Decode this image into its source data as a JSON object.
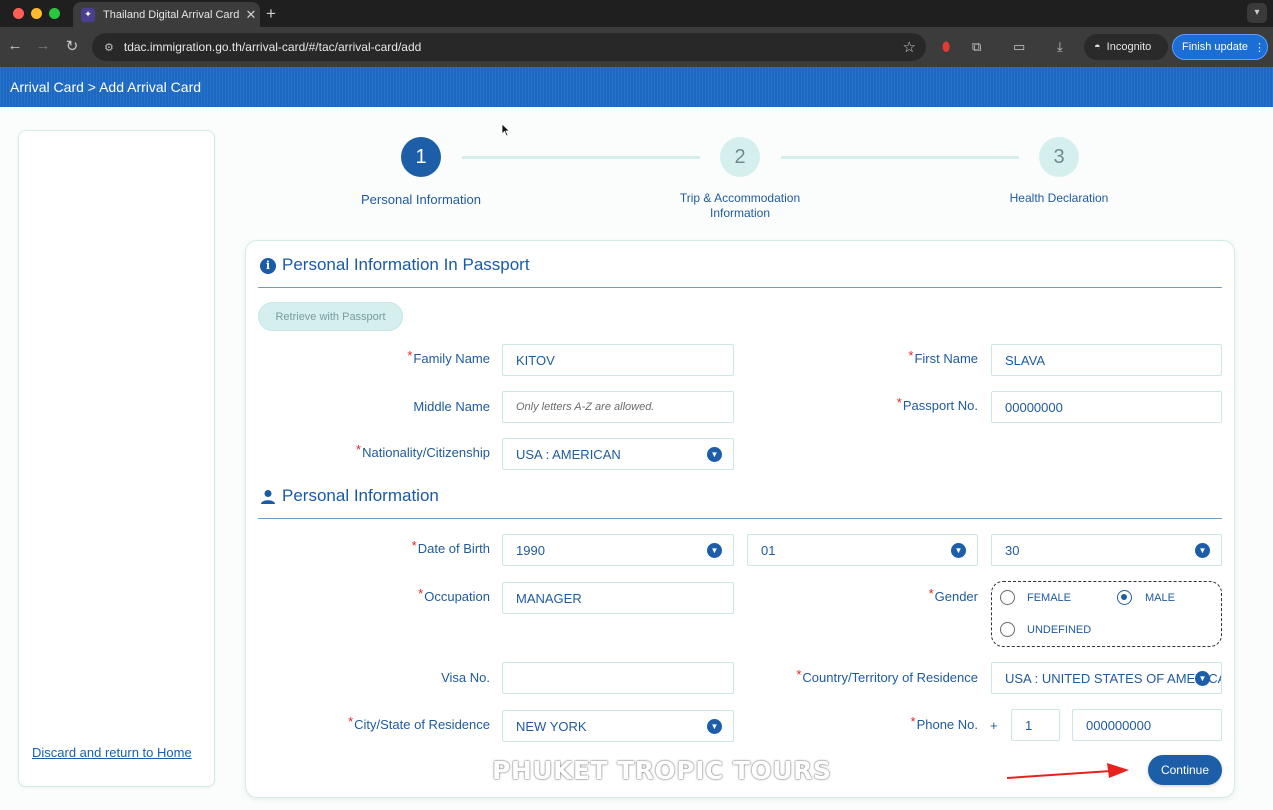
{
  "browser": {
    "tab_title": "Thailand Digital Arrival Card",
    "url": "tdac.immigration.go.th/arrival-card/#/tac/arrival-card/add",
    "incognito_label": "Incognito",
    "update_label": "Finish update"
  },
  "header": {
    "breadcrumb": "Arrival Card > Add Arrival Card"
  },
  "sidebar": {
    "discard_link": "Discard and return to Home"
  },
  "steps": [
    {
      "number": "1",
      "label": "Personal Information",
      "active": true
    },
    {
      "number": "2",
      "label_line1": "Trip & Accommodation",
      "label_line2": "Information",
      "active": false
    },
    {
      "number": "3",
      "label": "Health Declaration",
      "active": false
    }
  ],
  "passport_section": {
    "title": "Personal Information In Passport",
    "retrieve_button": "Retrieve with Passport",
    "family_name": {
      "label": "Family Name",
      "value": "KITOV"
    },
    "first_name": {
      "label": "First Name",
      "value": "SLAVA"
    },
    "middle_name": {
      "label": "Middle Name",
      "placeholder": "Only letters A-Z are allowed."
    },
    "passport_no": {
      "label": "Passport No.",
      "value": "00000000"
    },
    "nationality": {
      "label": "Nationality/Citizenship",
      "value": "USA : AMERICAN"
    }
  },
  "personal_section": {
    "title": "Personal Information",
    "dob": {
      "label": "Date of Birth",
      "year": "1990",
      "month": "01",
      "day": "30"
    },
    "occupation": {
      "label": "Occupation",
      "value": "MANAGER"
    },
    "gender": {
      "label": "Gender",
      "options": [
        "FEMALE",
        "MALE",
        "UNDEFINED"
      ],
      "selected": "MALE"
    },
    "visa_no": {
      "label": "Visa No.",
      "value": ""
    },
    "country_residence": {
      "label": "Country/Territory of Residence",
      "value": "USA : UNITED STATES OF AMERICA"
    },
    "city_residence": {
      "label": "City/State of Residence",
      "value": "NEW YORK"
    },
    "phone": {
      "label": "Phone No.",
      "plus": "+",
      "country_code": "1",
      "number": "000000000"
    }
  },
  "continue_button": "Continue",
  "watermark": "PHUKET TROPIC TOURS",
  "colors": {
    "brand_blue": "#1c69c4",
    "primary": "#1d5ea8",
    "required": "#e0242a",
    "annotation_arrow": "#e8221c"
  }
}
